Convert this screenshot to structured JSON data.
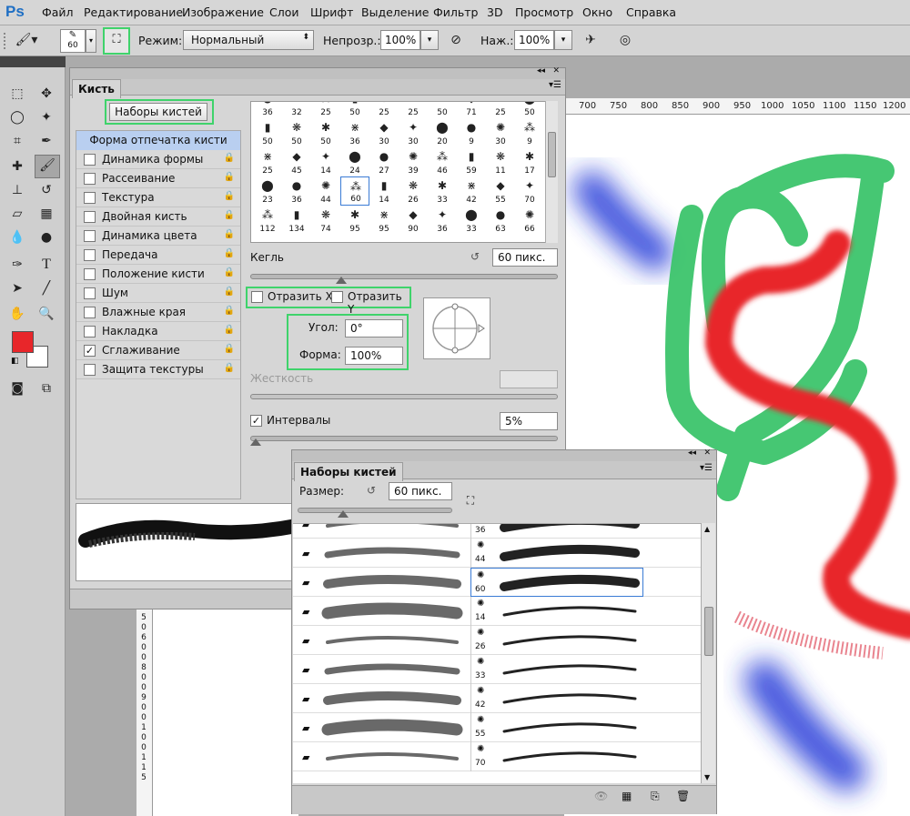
{
  "app": {
    "logo": "Ps"
  },
  "menu": [
    "Файл",
    "Редактирование",
    "Изображение",
    "Слои",
    "Шрифт",
    "Выделение",
    "Фильтр",
    "3D",
    "Просмотр",
    "Окно",
    "Справка"
  ],
  "options": {
    "brush_size": "60",
    "mode_label": "Режим:",
    "mode_value": "Нормальный",
    "opacity_label": "Непрозр.:",
    "opacity_value": "100%",
    "flow_label": "Наж.:",
    "flow_value": "100%"
  },
  "ruler_ticks": [
    "700",
    "750",
    "800",
    "850",
    "900",
    "950",
    "1000",
    "1050",
    "1100",
    "1150",
    "1200"
  ],
  "brush_panel": {
    "tab": "Кисть",
    "presets_button": "Наборы кистей",
    "tip_shape": "Форма отпечатка кисти",
    "options": [
      {
        "label": "Динамика формы",
        "checked": false
      },
      {
        "label": "Рассеивание",
        "checked": false
      },
      {
        "label": "Текстура",
        "checked": false
      },
      {
        "label": "Двойная кисть",
        "checked": false
      },
      {
        "label": "Динамика цвета",
        "checked": false
      },
      {
        "label": "Передача",
        "checked": false
      },
      {
        "label": "Положение кисти",
        "checked": false
      },
      {
        "label": "Шум",
        "checked": false
      },
      {
        "label": "Влажные края",
        "checked": false
      },
      {
        "label": "Накладка",
        "checked": false
      },
      {
        "label": "Сглаживание",
        "checked": true
      },
      {
        "label": "Защита текстуры",
        "checked": false
      }
    ],
    "tip_rows": [
      [
        "36",
        "32",
        "25",
        "50",
        "25",
        "25",
        "50",
        "71",
        "25",
        "50"
      ],
      [
        "50",
        "50",
        "50",
        "36",
        "30",
        "30",
        "20",
        "9",
        "30",
        "9"
      ],
      [
        "25",
        "45",
        "14",
        "24",
        "27",
        "39",
        "46",
        "59",
        "11",
        "17"
      ],
      [
        "23",
        "36",
        "44",
        "60",
        "14",
        "26",
        "33",
        "42",
        "55",
        "70"
      ],
      [
        "112",
        "134",
        "74",
        "95",
        "95",
        "90",
        "36",
        "33",
        "63",
        "66"
      ]
    ],
    "size_label": "Кегль",
    "size_value": "60 пикс.",
    "flip_x": "Отразить X",
    "flip_y": "Отразить Y",
    "angle_label": "Угол:",
    "angle_value": "0°",
    "roundness_label": "Форма:",
    "roundness_value": "100%",
    "hardness_label": "Жесткость",
    "spacing_label": "Интервалы",
    "spacing_value": "5%"
  },
  "presets_panel": {
    "tab": "Наборы кистей",
    "size_label": "Размер:",
    "size_value": "60 пикс.",
    "rows": [
      {
        "num": "36"
      },
      {
        "num": "44"
      },
      {
        "num": "60"
      },
      {
        "num": "14"
      },
      {
        "num": "26"
      },
      {
        "num": "33"
      },
      {
        "num": "42"
      },
      {
        "num": "55"
      },
      {
        "num": "70"
      }
    ]
  },
  "ruler_left_digits": [
    "5",
    "0",
    "6",
    "0",
    "0",
    "8",
    "0",
    "0",
    "9",
    "0",
    "0",
    "1",
    "0",
    "0",
    "1",
    "1",
    "5"
  ],
  "colors": {
    "foreground": "#e8262a",
    "background": "#ffffff",
    "highlight": "#3fd36b",
    "green_paint": "#3cc46c",
    "red_paint": "#e8262a",
    "blue_paint": "#2238d8"
  }
}
